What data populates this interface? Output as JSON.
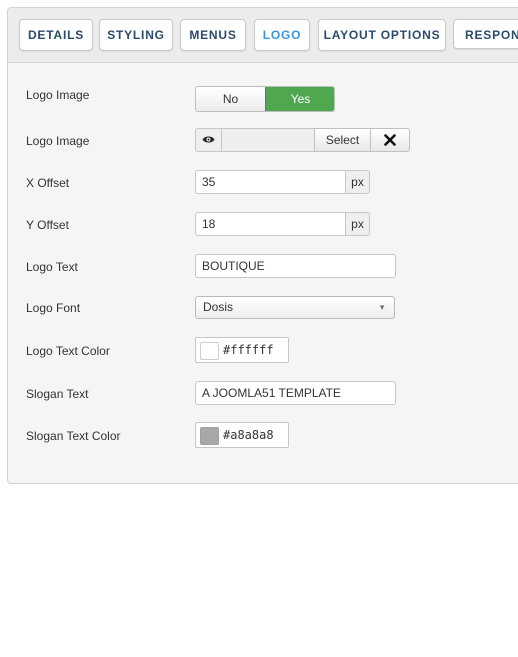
{
  "tabs": [
    {
      "label": "DETAILS"
    },
    {
      "label": "STYLING"
    },
    {
      "label": "MENUS"
    },
    {
      "label": "LOGO",
      "active": true
    },
    {
      "label": "LAYOUT OPTIONS"
    },
    {
      "label": "RESPONSI"
    }
  ],
  "form": {
    "logo_image_toggle": {
      "label": "Logo Image",
      "no_label": "No",
      "yes_label": "Yes",
      "selected": "Yes",
      "active_color": "#4fa84f"
    },
    "logo_image_media": {
      "label": "Logo Image",
      "preview_icon": "eye-icon",
      "value": "",
      "select_label": "Select",
      "clear_icon": "close-icon"
    },
    "x_offset": {
      "label": "X Offset",
      "value": "35",
      "unit": "px"
    },
    "y_offset": {
      "label": "Y Offset",
      "value": "18",
      "unit": "px"
    },
    "logo_text": {
      "label": "Logo Text",
      "value": "BOUTIQUE"
    },
    "logo_font": {
      "label": "Logo Font",
      "value": "Dosis"
    },
    "logo_text_color": {
      "label": "Logo Text Color",
      "value": "#ffffff",
      "swatch_color": "#ffffff"
    },
    "slogan_text": {
      "label": "Slogan Text",
      "value": "A JOOMLA51 TEMPLATE"
    },
    "slogan_text_color": {
      "label": "Slogan Text Color",
      "value": "#a8a8a8",
      "swatch_color": "#a8a8a8"
    }
  }
}
